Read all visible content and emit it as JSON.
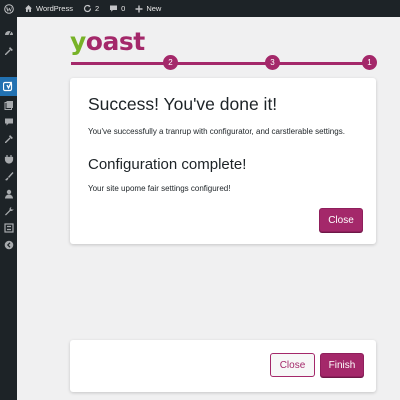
{
  "adminbar": {
    "site_name": "WordPress",
    "updates_count": "2",
    "comments_count": "0",
    "new_label": "New"
  },
  "sidebar": {
    "icons": [
      "dashboard-icon",
      "posts-icon",
      "yoast-icon",
      "media-icon",
      "comments-icon",
      "pin-icon",
      "plugins-icon",
      "appearance-icon",
      "users-icon",
      "tools-icon",
      "settings-icon",
      "collapse-icon"
    ]
  },
  "logo": {
    "first_letter": "y",
    "rest": "oast"
  },
  "steps": [
    {
      "label": "2"
    },
    {
      "label": "3"
    },
    {
      "label": "1"
    }
  ],
  "success_card": {
    "title": "Success! You've done it!",
    "message": "You've successfully a tranrup with configurator, and carstlerable settings.",
    "subtitle": "Configuration complete!",
    "detail": "Your site upome fair settings configured!",
    "close_label": "Close"
  },
  "footer_card": {
    "close_label": "Close",
    "finish_label": "Finish"
  },
  "colors": {
    "brand": "#a4286a",
    "logo_accent": "#77b227",
    "admin_dark": "#1d2327",
    "admin_current": "#2271b1"
  }
}
